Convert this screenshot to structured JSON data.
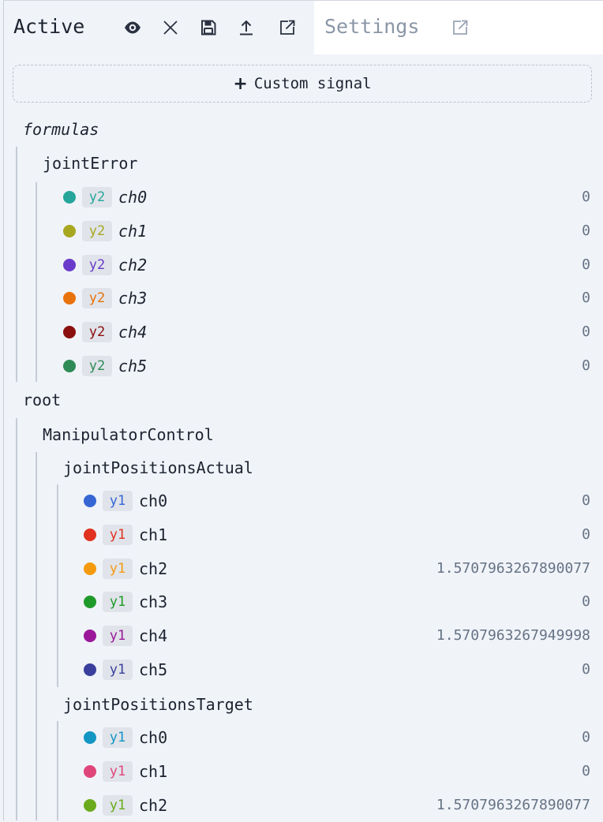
{
  "tabs": {
    "active_label": "Active",
    "settings_label": "Settings"
  },
  "toolbar_icons": [
    "eye-icon",
    "close-icon",
    "save-icon",
    "upload-icon",
    "external-link-icon"
  ],
  "custom_signal": {
    "label": "Custom signal",
    "icon": "plus-icon"
  },
  "formulas": {
    "label": "formulas",
    "jointError": {
      "label": "jointError",
      "channels": [
        {
          "axis": "y2",
          "name": "ch0",
          "value": "0",
          "color": "#26a69a"
        },
        {
          "axis": "y2",
          "name": "ch1",
          "value": "0",
          "color": "#a8a820"
        },
        {
          "axis": "y2",
          "name": "ch2",
          "value": "0",
          "color": "#6a3bcb"
        },
        {
          "axis": "y2",
          "name": "ch3",
          "value": "0",
          "color": "#e8720c"
        },
        {
          "axis": "y2",
          "name": "ch4",
          "value": "0",
          "color": "#8b0f0f"
        },
        {
          "axis": "y2",
          "name": "ch5",
          "value": "0",
          "color": "#2e8b57"
        }
      ]
    }
  },
  "root": {
    "label": "root",
    "ManipulatorControl": {
      "label": "ManipulatorControl",
      "jointPositionsActual": {
        "label": "jointPositionsActual",
        "channels": [
          {
            "axis": "y1",
            "name": "ch0",
            "value": "0",
            "color": "#3566d4"
          },
          {
            "axis": "y1",
            "name": "ch1",
            "value": "0",
            "color": "#e0321e"
          },
          {
            "axis": "y1",
            "name": "ch2",
            "value": "1.5707963267890077",
            "color": "#f59a0f"
          },
          {
            "axis": "y1",
            "name": "ch3",
            "value": "0",
            "color": "#1f9a2a"
          },
          {
            "axis": "y1",
            "name": "ch4",
            "value": "1.5707963267949998",
            "color": "#9a179a"
          },
          {
            "axis": "y1",
            "name": "ch5",
            "value": "0",
            "color": "#3a3f9e"
          }
        ]
      },
      "jointPositionsTarget": {
        "label": "jointPositionsTarget",
        "channels": [
          {
            "axis": "y1",
            "name": "ch0",
            "value": "0",
            "color": "#1496c4"
          },
          {
            "axis": "y1",
            "name": "ch1",
            "value": "0",
            "color": "#e0457a"
          },
          {
            "axis": "y1",
            "name": "ch2",
            "value": "1.5707963267890077",
            "color": "#6aaa1c"
          }
        ]
      }
    }
  }
}
